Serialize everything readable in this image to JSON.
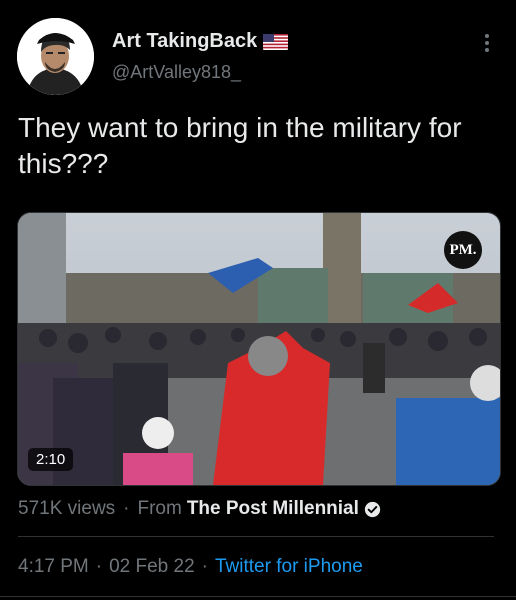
{
  "author": {
    "display_name": "Art TakingBack",
    "handle": "@ArtValley818_",
    "flag_icon": "us-flag-icon"
  },
  "tweet": {
    "text": "They want to bring in the military for this???"
  },
  "media": {
    "duration": "2:10",
    "watermark": "PM.",
    "views": "571K views",
    "from_label": "From",
    "source": "The Post Millennial"
  },
  "meta": {
    "time": "4:17 PM",
    "date": "02 Feb 22",
    "app": "Twitter for iPhone"
  },
  "colors": {
    "background": "#000000",
    "text": "#e7e9ea",
    "secondary": "#71767b",
    "link": "#1d9bf0"
  }
}
